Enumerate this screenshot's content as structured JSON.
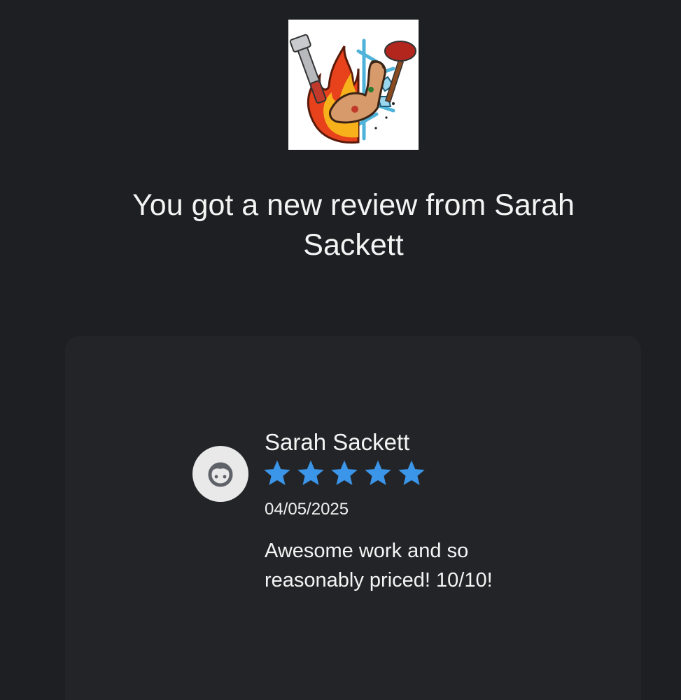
{
  "logo": {
    "icon": "plumbing-hvac-logo-icon",
    "description_hidden": false
  },
  "headline": {
    "text": "You got a new review from Sarah Sackett"
  },
  "review": {
    "reviewer_name": "Sarah Sackett",
    "avatar_icon": "face-avatar-icon",
    "rating": 5,
    "rating_max": 5,
    "star_color": "#3b95e8",
    "date": "04/05/2025",
    "text": "Awesome work and so reasonably priced! 10/10!"
  },
  "colors": {
    "background": "#1e1f22",
    "card": "#232427",
    "text": "#f4f4f4",
    "avatar_bg": "#e9e9ea",
    "avatar_face": "#5f6268"
  }
}
